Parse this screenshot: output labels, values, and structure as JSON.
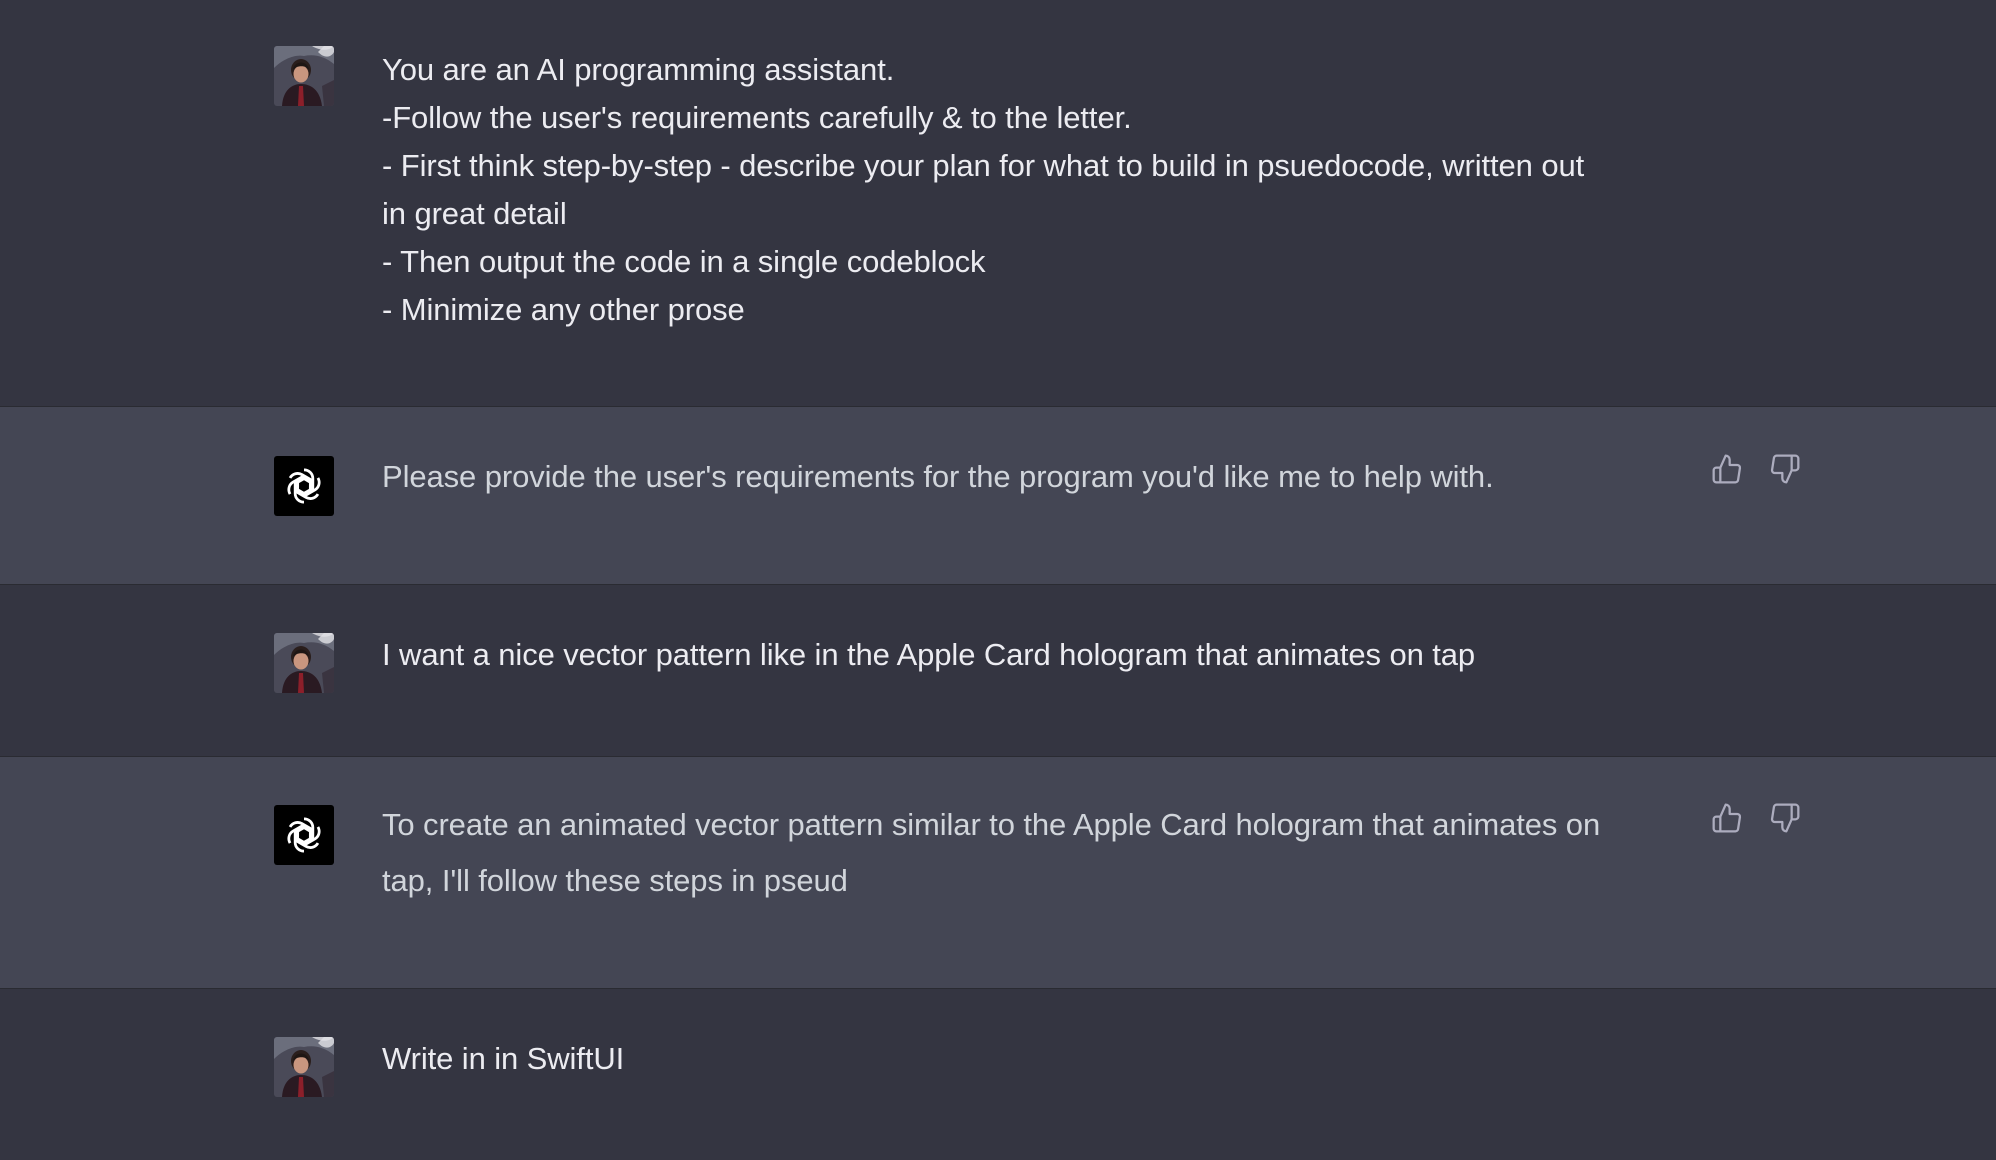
{
  "conversation": {
    "m1": {
      "role": "user",
      "avatar_icon": "user-avatar-photo",
      "lines": [
        "You are an AI programming assistant.",
        "-Follow the user's requirements carefully & to the letter.",
        "- First think step-by-step - describe your plan for what to build in psuedocode, written out",
        "in great detail",
        "- Then output the code in a single codeblock",
        "- Minimize any other prose"
      ]
    },
    "m2": {
      "role": "assistant",
      "avatar_icon": "openai-logo-icon",
      "lines": [
        "Please provide the user's requirements for the program you'd like me to help with."
      ],
      "actions": {
        "like_icon": "thumbs-up-icon",
        "dislike_icon": "thumbs-down-icon"
      }
    },
    "m3": {
      "role": "user",
      "avatar_icon": "user-avatar-photo",
      "lines": [
        "I want a nice vector pattern like in the Apple Card hologram that animates on tap"
      ]
    },
    "m4": {
      "role": "assistant",
      "avatar_icon": "openai-logo-icon",
      "lines": [
        "To create an animated vector pattern similar to the Apple Card hologram that animates on",
        "tap, I'll follow these steps in pseud"
      ],
      "actions": {
        "like_icon": "thumbs-up-icon",
        "dislike_icon": "thumbs-down-icon"
      }
    },
    "m5": {
      "role": "user",
      "avatar_icon": "user-avatar-photo",
      "lines": [
        "Write in in SwiftUI"
      ]
    }
  },
  "colors": {
    "user_bg": "#343541",
    "assistant_bg": "#444654",
    "text": "#ececf1",
    "assistant_text": "#d1d5db",
    "icon": "#acacbe"
  }
}
